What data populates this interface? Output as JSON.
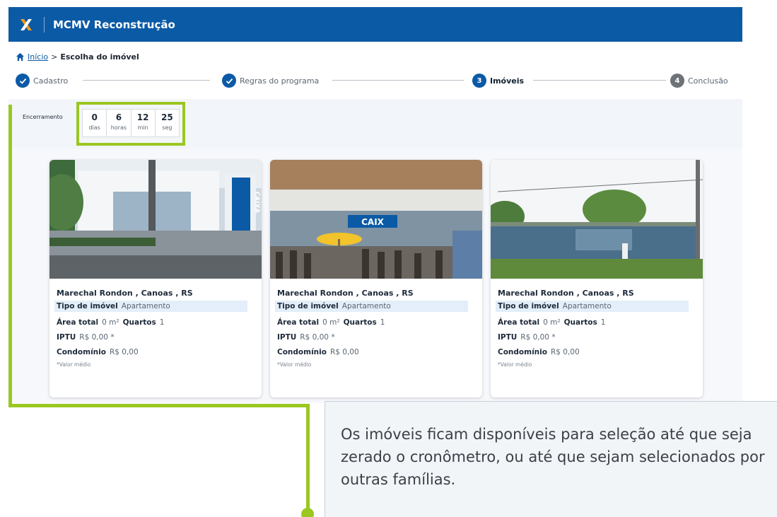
{
  "header": {
    "app_title": "MCMV Reconstrução",
    "brand_color": "#0b5aa6"
  },
  "breadcrumb": {
    "home_label": "Início",
    "separator": ">",
    "current": "Escolha do imóvel"
  },
  "stepper": {
    "steps": [
      {
        "label": "Cadastro",
        "state": "done",
        "icon": "check-icon"
      },
      {
        "label": "Regras do programa",
        "state": "done",
        "icon": "check-icon"
      },
      {
        "label": "Imóveis",
        "state": "active",
        "number": "3"
      },
      {
        "label": "Conclusão",
        "state": "pending",
        "number": "4"
      }
    ]
  },
  "timer": {
    "label": "Encerramento",
    "units": [
      {
        "value": "0",
        "label": "dias"
      },
      {
        "value": "6",
        "label": "horas"
      },
      {
        "value": "12",
        "label": "min"
      },
      {
        "value": "25",
        "label": "seg"
      }
    ],
    "highlight_color": "#9ac722"
  },
  "cards": [
    {
      "address": "Marechal Rondon , Canoas , RS",
      "tipo_label": "Tipo de imóvel",
      "tipo_value": "Apartamento",
      "area_label": "Área total",
      "area_value": "0 m²",
      "quartos_label": "Quartos",
      "quartos_value": "1",
      "iptu_label": "IPTU",
      "iptu_value": "R$ 0,00 *",
      "condominio_label": "Condomínio",
      "condominio_value": "R$ 0,00",
      "note": "*Valor médio",
      "photo_sign": "CAIXA"
    },
    {
      "address": "Marechal Rondon , Canoas , RS",
      "tipo_label": "Tipo de imóvel",
      "tipo_value": "Apartamento",
      "area_label": "Área total",
      "area_value": "0 m²",
      "quartos_label": "Quartos",
      "quartos_value": "1",
      "iptu_label": "IPTU",
      "iptu_value": "R$ 0,00 *",
      "condominio_label": "Condomínio",
      "condominio_value": "R$ 0,00",
      "note": "*Valor médio",
      "photo_sign": "CAIX"
    },
    {
      "address": "Marechal Rondon , Canoas , RS",
      "tipo_label": "Tipo de imóvel",
      "tipo_value": "Apartamento",
      "area_label": "Área total",
      "area_value": "0 m²",
      "quartos_label": "Quartos",
      "quartos_value": "1",
      "iptu_label": "IPTU",
      "iptu_value": "R$ 0,00 *",
      "condominio_label": "Condomínio",
      "condominio_value": "R$ 0,00",
      "note": "*Valor médio"
    }
  ],
  "callout": {
    "text": "Os imóveis ficam disponíveis para seleção até que seja zerado o cronômetro, ou até que sejam selecionados por outras famílias."
  }
}
